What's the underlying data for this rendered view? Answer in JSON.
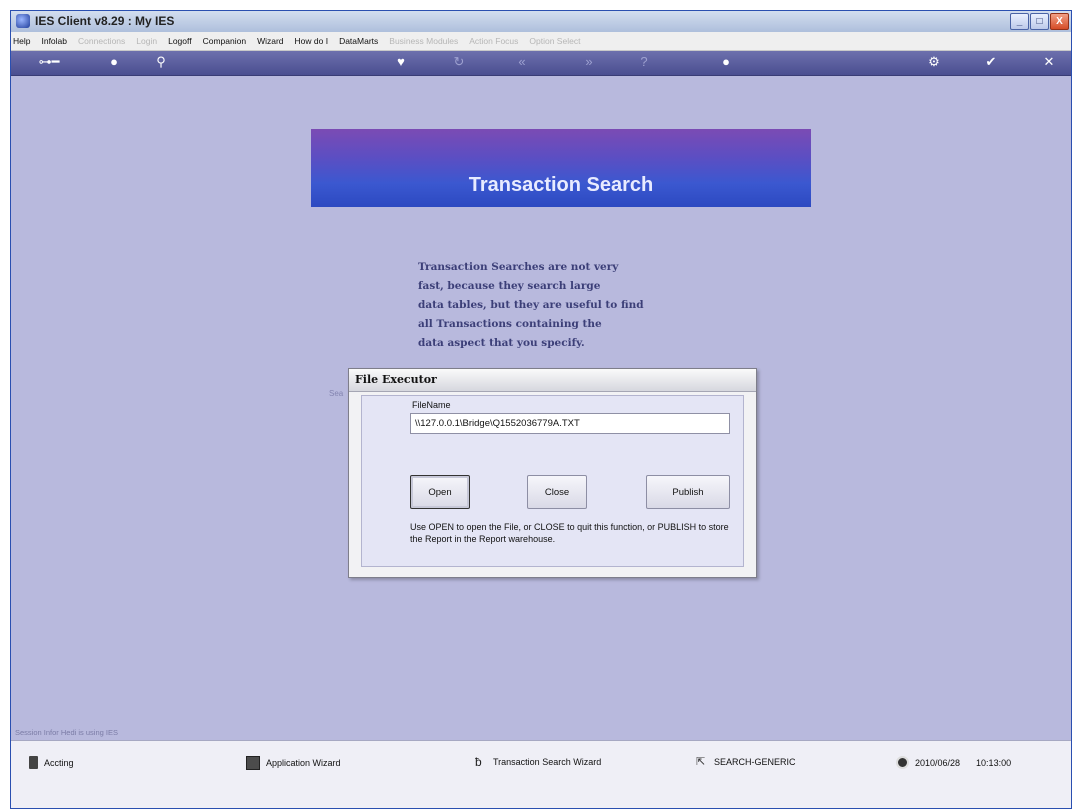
{
  "window": {
    "title": "IES Client v8.29 : My IES",
    "controls": {
      "minimize": "_",
      "maximize": "□",
      "close": "X"
    }
  },
  "menu": {
    "items": [
      {
        "label": "Help",
        "enabled": true
      },
      {
        "label": "Infolab",
        "enabled": true
      },
      {
        "label": "Connections",
        "enabled": false
      },
      {
        "label": "Login",
        "enabled": false
      },
      {
        "label": "Logoff",
        "enabled": true
      },
      {
        "label": "Companion",
        "enabled": true
      },
      {
        "label": "Wizard",
        "enabled": true
      },
      {
        "label": "How do I",
        "enabled": true
      },
      {
        "label": "DataMarts",
        "enabled": true
      },
      {
        "label": "Business Modules",
        "enabled": false
      },
      {
        "label": "Action Focus",
        "enabled": false
      },
      {
        "label": "Option Select",
        "enabled": false
      }
    ]
  },
  "toolbar": {
    "icons": [
      "key-icon",
      "info-icon",
      "search-icon",
      "heart-icon",
      "refresh-icon",
      "back-icon",
      "forward-icon",
      "help-icon",
      "circle-icon",
      "settings-icon",
      "check-icon",
      "close-icon"
    ]
  },
  "page": {
    "title": "Transaction Search",
    "description": "Transaction Searches are not very\nfast, because they search large\ndata tables, but they are useful to find\nall Transactions containing the\ndata aspect that you specify.",
    "partially_hidden_label": "Sea"
  },
  "dialog": {
    "title": "File Executor",
    "field_label": "FileName",
    "field_value": "\\\\127.0.0.1\\Bridge\\Q1552036779A.TXT",
    "open_label": "Open",
    "close_label": "Close",
    "publish_label": "Publish",
    "help_text": "Use OPEN to open the File, or CLOSE to quit this function, or PUBLISH to store the Report in the Report warehouse."
  },
  "status": {
    "line": "Session Infor Hedi is using IES"
  },
  "taskbar": {
    "accounting": "Accting",
    "app_wizard": "Application Wizard",
    "txn_wizard": "Transaction Search Wizard",
    "search_generic": "SEARCH-GENERIC",
    "date": "2010/06/28",
    "time": "10:13:00"
  }
}
